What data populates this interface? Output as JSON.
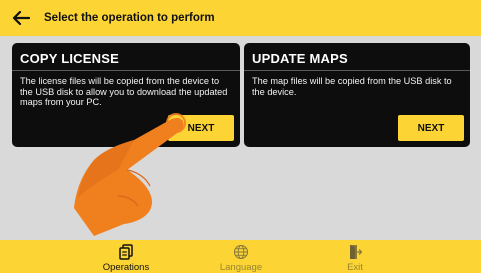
{
  "header": {
    "title": "Select the operation to perform",
    "back_icon": "arrow-left-icon"
  },
  "cards": [
    {
      "title": "COPY LICENSE",
      "description": "The license files will be copied from the device to the USB disk to allow you to download the updated maps from your PC.",
      "button_label": "NEXT"
    },
    {
      "title": "UPDATE MAPS",
      "description": "The map files will be copied from the USB disk to the device.",
      "button_label": "NEXT"
    }
  ],
  "nav": {
    "items": [
      {
        "label": "Operations",
        "icon": "document-copy-icon",
        "active": true
      },
      {
        "label": "Language",
        "icon": "globe-icon",
        "active": false
      },
      {
        "label": "Exit",
        "icon": "exit-door-icon",
        "active": false
      }
    ]
  },
  "colors": {
    "accent": "#fcd535",
    "card_background": "#0d0d0d",
    "page_background": "#d9d9d9",
    "hand": "#f07f1e"
  }
}
